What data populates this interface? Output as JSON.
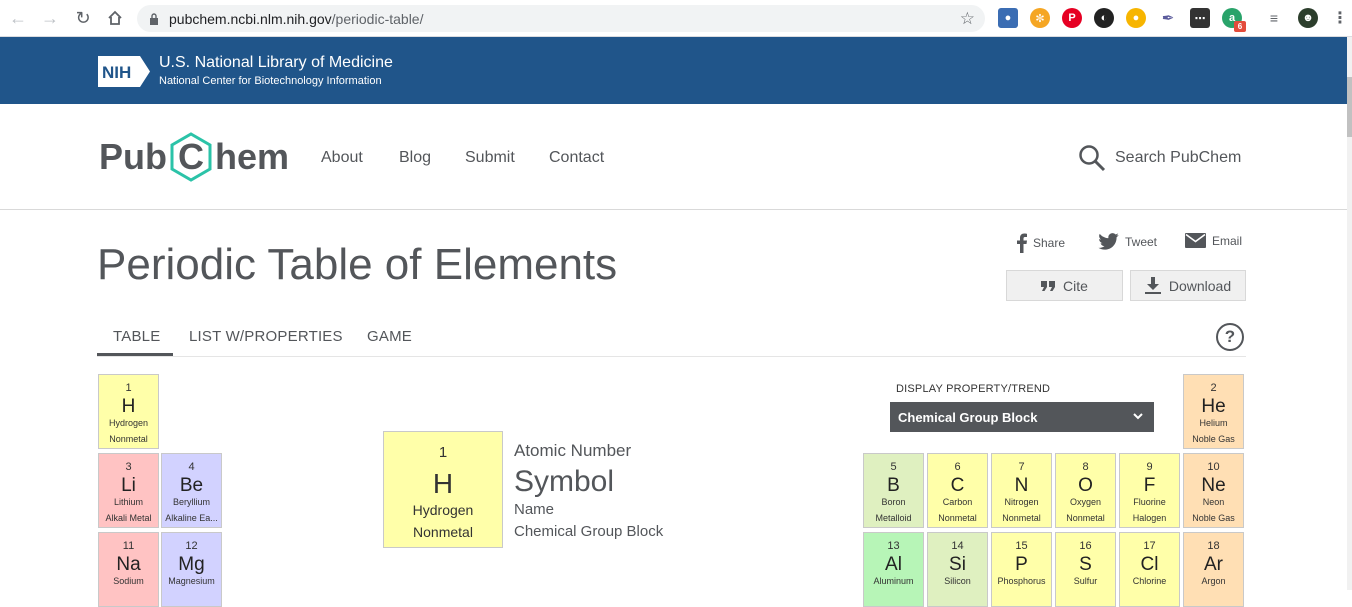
{
  "browser": {
    "url_host": "pubchem.ncbi.nlm.nih.gov",
    "url_path": "/periodic-table/",
    "extension_badge": "6"
  },
  "nih": {
    "logo_text": "NIH",
    "title": "U.S. National Library of Medicine",
    "subtitle": "National Center for Biotechnology Information"
  },
  "header": {
    "logo_left": "Pub",
    "logo_mid": "C",
    "logo_right": "hem",
    "nav": [
      "About",
      "Blog",
      "Submit",
      "Contact"
    ],
    "search_label": "Search PubChem"
  },
  "page": {
    "title": "Periodic Table of Elements",
    "share": "Share",
    "tweet": "Tweet",
    "email": "Email",
    "cite": "Cite",
    "download": "Download"
  },
  "tabs": [
    "TABLE",
    "LIST W/PROPERTIES",
    "GAME"
  ],
  "help_icon": "?",
  "legend": {
    "num": "1",
    "sym": "H",
    "name": "Hydrogen",
    "group": "Nonmetal",
    "labels": {
      "atomic_number": "Atomic Number",
      "symbol": "Symbol",
      "name": "Name",
      "group": "Chemical Group Block"
    }
  },
  "display_property": {
    "label": "DISPLAY PROPERTY/TREND",
    "selected": "Chemical Group Block"
  },
  "elements": [
    {
      "num": "1",
      "sym": "H",
      "name": "Hydrogen",
      "group": "Nonmetal",
      "cls": "nonmetal"
    },
    {
      "num": "2",
      "sym": "He",
      "name": "Helium",
      "group": "Noble Gas",
      "cls": "noble"
    },
    {
      "num": "3",
      "sym": "Li",
      "name": "Lithium",
      "group": "Alkali Metal",
      "cls": "alkali"
    },
    {
      "num": "4",
      "sym": "Be",
      "name": "Beryllium",
      "group": "Alkaline Ea...",
      "cls": "alkaline"
    },
    {
      "num": "5",
      "sym": "B",
      "name": "Boron",
      "group": "Metalloid",
      "cls": "metalloid"
    },
    {
      "num": "6",
      "sym": "C",
      "name": "Carbon",
      "group": "Nonmetal",
      "cls": "nonmetal"
    },
    {
      "num": "7",
      "sym": "N",
      "name": "Nitrogen",
      "group": "Nonmetal",
      "cls": "nonmetal"
    },
    {
      "num": "8",
      "sym": "O",
      "name": "Oxygen",
      "group": "Nonmetal",
      "cls": "nonmetal"
    },
    {
      "num": "9",
      "sym": "F",
      "name": "Fluorine",
      "group": "Halogen",
      "cls": "halogen"
    },
    {
      "num": "10",
      "sym": "Ne",
      "name": "Neon",
      "group": "Noble Gas",
      "cls": "noble"
    },
    {
      "num": "11",
      "sym": "Na",
      "name": "Sodium",
      "group": "",
      "cls": "alkali"
    },
    {
      "num": "12",
      "sym": "Mg",
      "name": "Magnesium",
      "group": "",
      "cls": "alkaline"
    },
    {
      "num": "13",
      "sym": "Al",
      "name": "Aluminum",
      "group": "",
      "cls": "postmetal"
    },
    {
      "num": "14",
      "sym": "Si",
      "name": "Silicon",
      "group": "",
      "cls": "metalloid"
    },
    {
      "num": "15",
      "sym": "P",
      "name": "Phosphorus",
      "group": "",
      "cls": "nonmetal"
    },
    {
      "num": "16",
      "sym": "S",
      "name": "Sulfur",
      "group": "",
      "cls": "nonmetal"
    },
    {
      "num": "17",
      "sym": "Cl",
      "name": "Chlorine",
      "group": "",
      "cls": "halogen"
    },
    {
      "num": "18",
      "sym": "Ar",
      "name": "Argon",
      "group": "",
      "cls": "noble"
    }
  ]
}
